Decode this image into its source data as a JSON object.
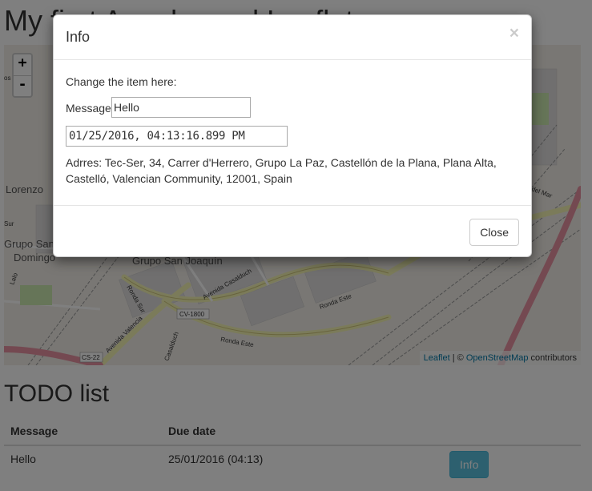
{
  "page": {
    "title": "My first Angular and Leaflet app"
  },
  "map": {
    "zoom_in": "+",
    "zoom_out": "-",
    "attribution": {
      "leaflet": "Leaflet",
      "sep": " | © ",
      "osm": "OpenStreetMap",
      "suffix": " contributors"
    },
    "labels": {
      "lorenzo": "Lorenzo",
      "grupo_san": "Grupo San",
      "domingo": "Domingo",
      "grupo_san_joaquin": "Grupo San Joaquín",
      "avenida_casalduch": "Avenida Casalduch",
      "ronda_sur": "Ronda Sur",
      "ronda_este_1": "Ronda Este",
      "ronda_este_2": "Ronda Este",
      "cv1800": "CV-1800",
      "avenida_valencia": "Avenida Valencia",
      "casalduch2": "Casalduch",
      "cs22": "CS-22",
      "del_mar": "del Mar",
      "sur": "Sur",
      "lalo": "Lalo",
      "os": "os"
    }
  },
  "todo": {
    "title": "TODO list",
    "headers": [
      "Message",
      "Due date",
      ""
    ],
    "rows": [
      {
        "message": "Hello",
        "due": "25/01/2016 (04:13)",
        "action": "Info"
      }
    ]
  },
  "modal": {
    "title": "Info",
    "close_x": "×",
    "intro": "Change the item here:",
    "message_label": "Message",
    "message_value": "Hello",
    "date_value": "01/25/2016, 04:13:16.899 PM",
    "address": "Adrres: Tec-Ser, 34, Carrer d'Herrero, Grupo La Paz, Castellón de la Plana, Plana Alta, Castelló, Valencian Community, 12001, Spain",
    "close_button": "Close"
  }
}
